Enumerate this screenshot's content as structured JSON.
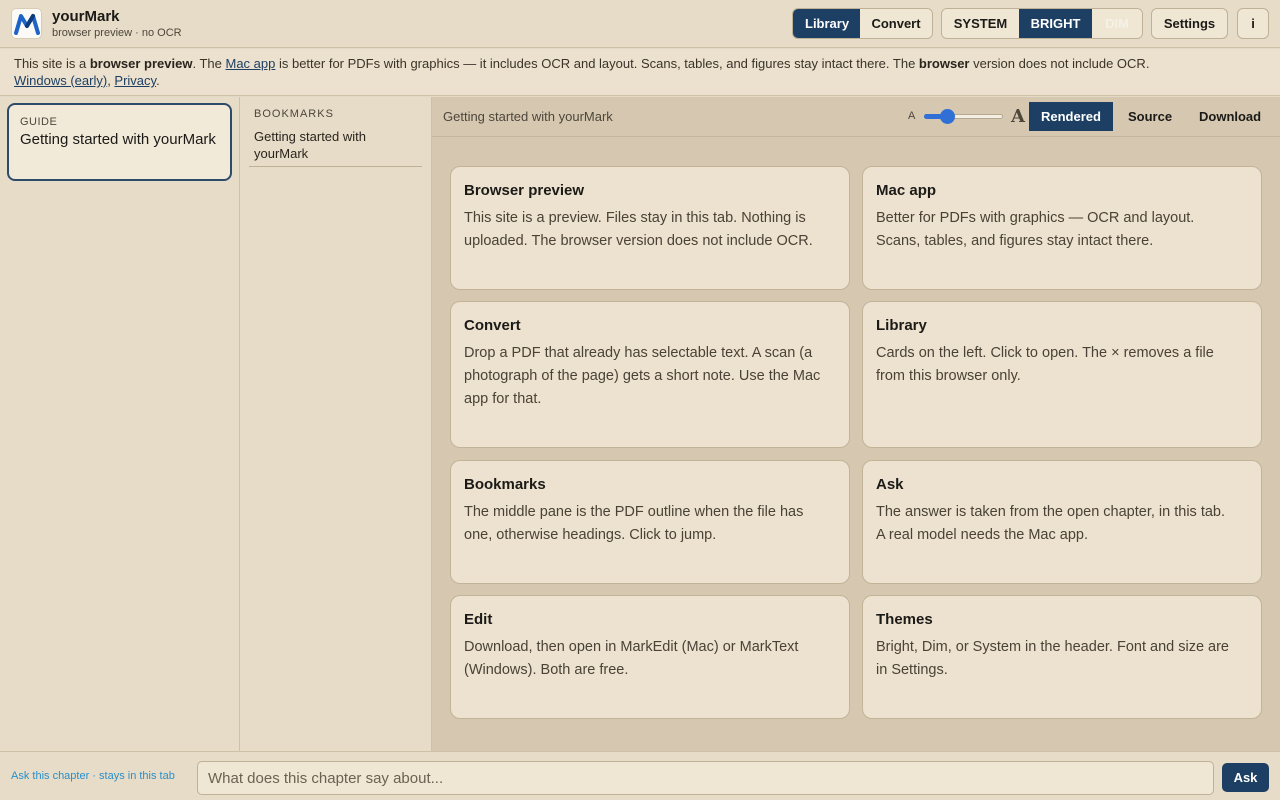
{
  "header": {
    "app_name": "yourMark",
    "app_subtitle": "browser preview · no OCR",
    "nav": [
      {
        "label": "Library",
        "active": true
      },
      {
        "label": "Convert",
        "active": false
      }
    ],
    "themes": [
      {
        "label": "SYSTEM",
        "active": false
      },
      {
        "label": "BRIGHT",
        "active": true
      },
      {
        "label": "DIM",
        "active": false
      }
    ],
    "settings_label": "Settings",
    "info_label": "i"
  },
  "notice": {
    "p1": "This site is a ",
    "b1": "browser preview",
    "p2": ". The ",
    "link_mac": "Mac app",
    "p3": " is better for PDFs with graphics — it includes OCR and layout. Scans, tables, and figures stay intact there. The ",
    "b2": "browser",
    "p4": " version does not include OCR.",
    "link_windows": "Windows (early)",
    "sep": ", ",
    "link_privacy": "Privacy",
    "end": "."
  },
  "library": {
    "items": [
      {
        "kicker": "GUIDE",
        "title": "Getting started with yourMark"
      }
    ]
  },
  "bookmarks": {
    "heading": "BOOKMARKS",
    "items": [
      {
        "label": "Getting started with yourMark"
      }
    ]
  },
  "toolbar": {
    "doc_title": "Getting started with yourMark",
    "font_small": "A",
    "font_large": "A",
    "font_size_fraction": 0.25,
    "views": [
      {
        "label": "Rendered",
        "active": true
      },
      {
        "label": "Source",
        "active": false
      },
      {
        "label": "Download",
        "active": false
      }
    ]
  },
  "cards": [
    {
      "title": "Browser preview",
      "body": "This site is a preview. Files stay in this tab. Nothing is uploaded. The browser version does not include OCR."
    },
    {
      "title": "Mac app",
      "body": "Better for PDFs with graphics — OCR and layout. Scans, tables, and figures stay intact there."
    },
    {
      "title": "Convert",
      "body": "Drop a PDF that already has selectable text. A scan (a photograph of the page) gets a short note. Use the Mac app for that."
    },
    {
      "title": "Library",
      "body": "Cards on the left. Click to open. The × removes a file from this browser only."
    },
    {
      "title": "Bookmarks",
      "body": "The middle pane is the PDF outline when the file has one, otherwise headings. Click to jump."
    },
    {
      "title": "Ask",
      "body": "The answer is taken from the open chapter, in this tab. A real model needs the Mac app."
    },
    {
      "title": "Edit",
      "body": "Download, then open in MarkEdit (Mac) or MarkText (Windows). Both are free."
    },
    {
      "title": "Themes",
      "body": "Bright, Dim, or System in the header. Font and size are in Settings."
    }
  ],
  "ask": {
    "hint": "Ask this chapter · stays in this tab",
    "placeholder": "What does this chapter say about...",
    "button": "Ask"
  },
  "colors": {
    "accent": "#1d3f63",
    "background": "#e4d9c4",
    "main_bg": "#d6c8b0",
    "link_blue": "#2a8fc9"
  },
  "icons": {
    "logo": "yourmark-logo-icon"
  }
}
